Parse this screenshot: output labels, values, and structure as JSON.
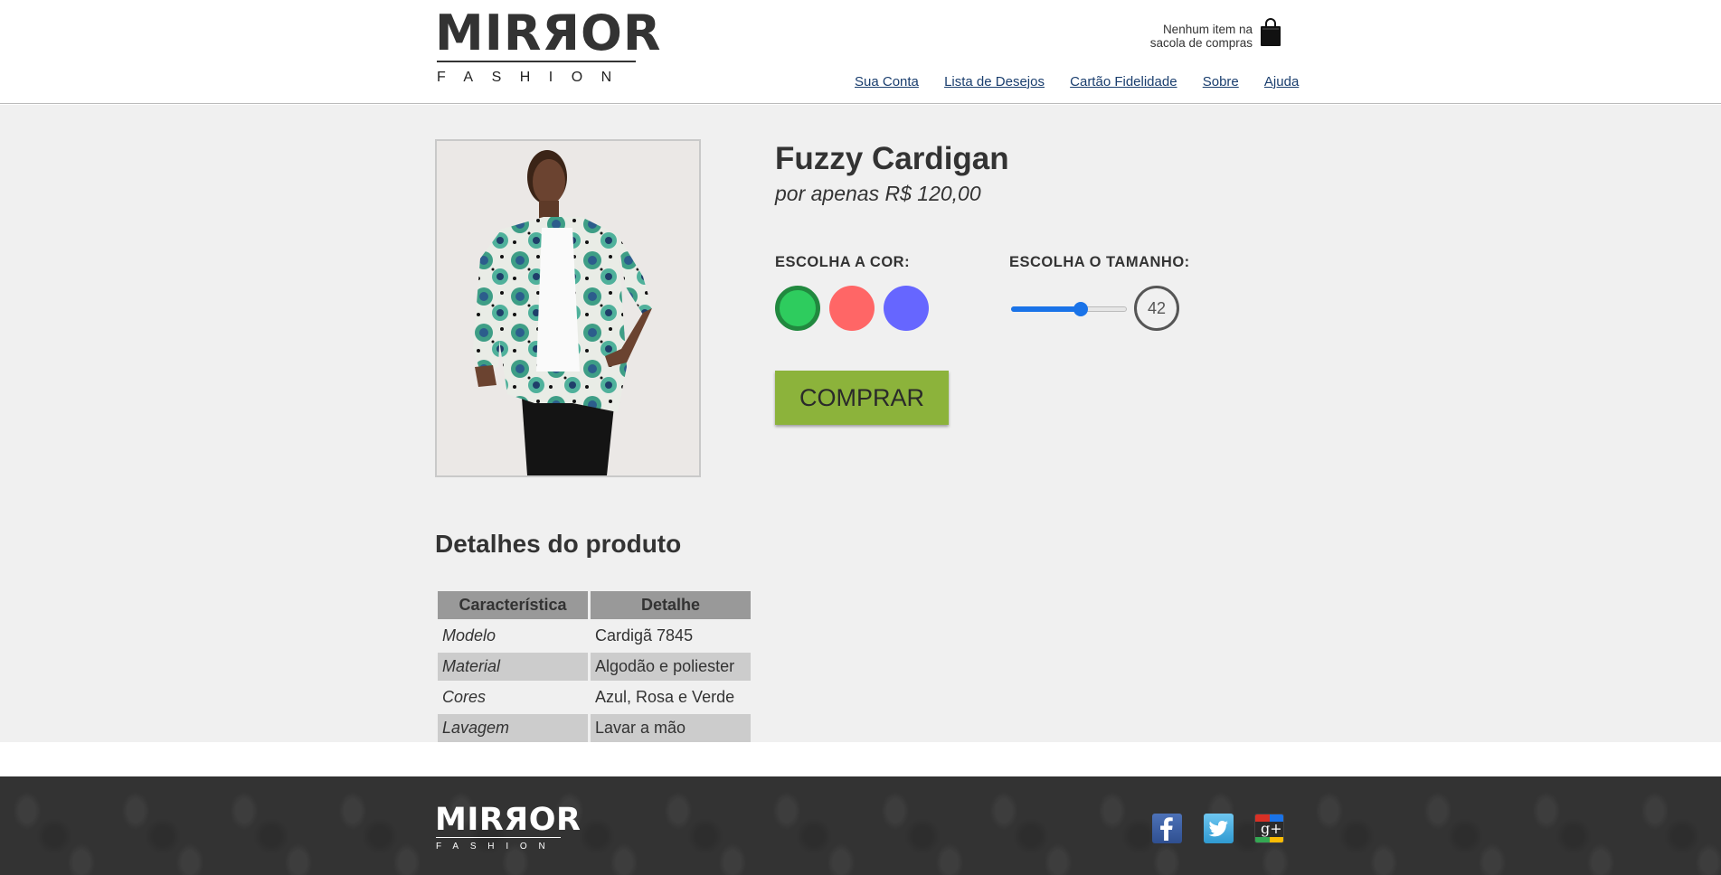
{
  "header": {
    "logo_word": "MIRЯOR",
    "logo_sub": "FASHION",
    "cart_line1": "Nenhum item na",
    "cart_line2": "sacola de compras",
    "nav": [
      "Sua Conta",
      "Lista de Desejos",
      "Cartão Fidelidade",
      "Sobre",
      "Ajuda"
    ]
  },
  "product": {
    "title": "Fuzzy Cardigan",
    "price": "por apenas R$ 120,00",
    "color_label": "ESCOLHA A COR:",
    "colors": [
      "#2ecc5e",
      "#ff6666",
      "#6666ff"
    ],
    "selected_color": "#2ecc5e",
    "size_label": "ESCOLHA O TAMANHO:",
    "size_value": "42",
    "size_slider_fraction": 0.6,
    "buy_label": "COMPRAR"
  },
  "details": {
    "title": "Detalhes do produto",
    "headers": [
      "Característica",
      "Detalhe"
    ],
    "rows": [
      [
        "Modelo",
        "Cardigã 7845"
      ],
      [
        "Material",
        "Algodão e poliester"
      ],
      [
        "Cores",
        "Azul, Rosa e Verde"
      ],
      [
        "Lavagem",
        "Lavar a mão"
      ]
    ]
  },
  "footer": {
    "logo_word": "MIRЯOR",
    "logo_sub": "FASHION",
    "social_icons": [
      "facebook-icon",
      "twitter-icon",
      "google-plus-icon"
    ],
    "gplus_glyph": "g+"
  }
}
